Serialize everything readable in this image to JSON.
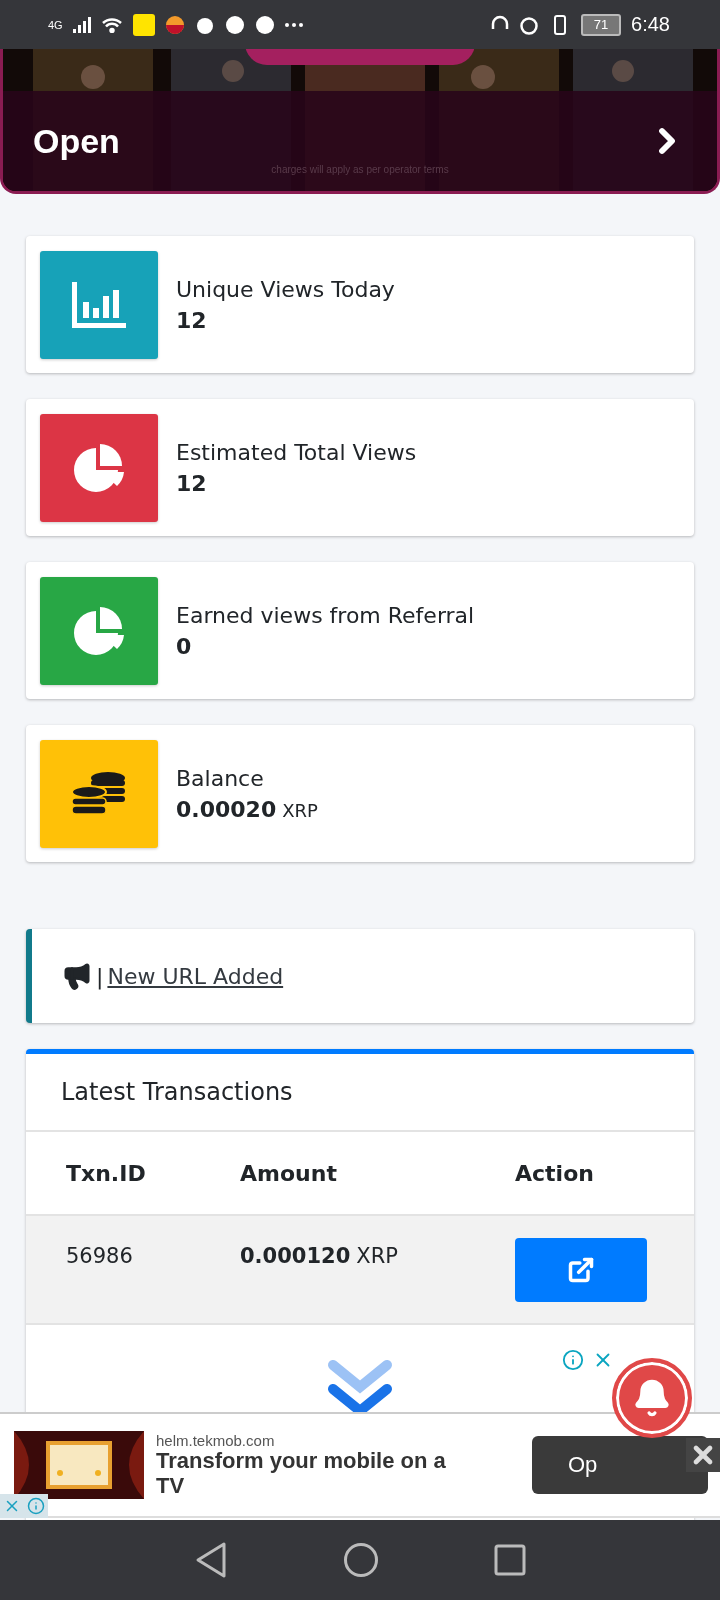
{
  "status_bar": {
    "network": "4G",
    "battery": "71",
    "time": "6:48"
  },
  "banner": {
    "action": "Open",
    "note": "charges will apply as per operator terms"
  },
  "stats": [
    {
      "kind": "bars",
      "label": "Unique Views Today",
      "value": "12",
      "color": "#17a2b8"
    },
    {
      "kind": "pie",
      "label": "Estimated Total Views",
      "value": "12",
      "color": "#dc3545"
    },
    {
      "kind": "pie",
      "label": "Earned views from Referral",
      "value": "0",
      "color": "#28a745"
    },
    {
      "kind": "coins",
      "label": "Balance",
      "value": "0.00020",
      "unit": "XRP",
      "color": "#ffc107"
    }
  ],
  "notice": {
    "separator": "|",
    "link": "New URL Added"
  },
  "transactions": {
    "title": "Latest Transactions",
    "columns": [
      "Txn.ID",
      "Amount",
      "Action"
    ],
    "rows": [
      {
        "id": "56986",
        "amount": "0.000120",
        "unit": "XRP"
      }
    ]
  },
  "ad": {
    "domain": "helm.tekmob.com",
    "headline": "Transform your mobile on a TV",
    "button": "Op"
  }
}
